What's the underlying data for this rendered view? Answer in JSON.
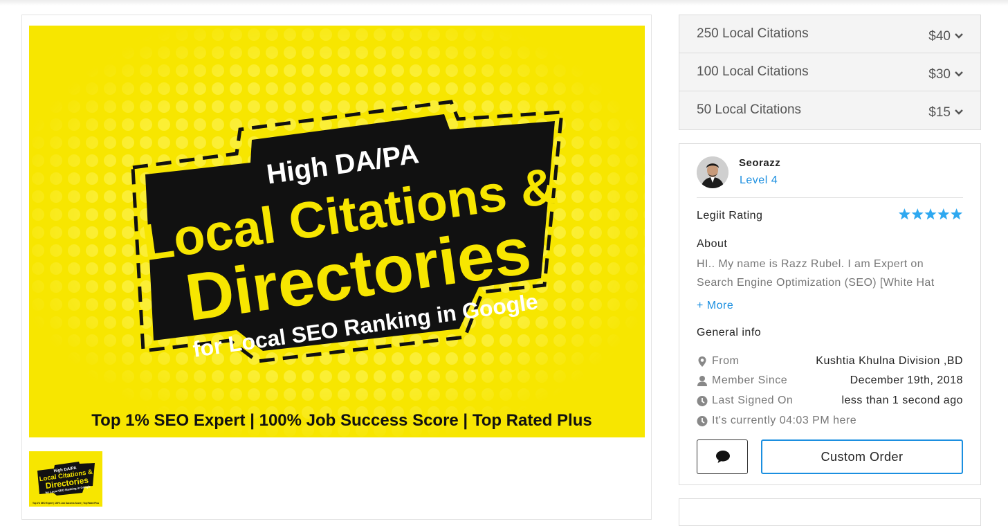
{
  "gallery": {
    "main_image": {
      "line1": "High DA/PA",
      "line2": "Local Citations &",
      "line3": "Directories",
      "line4": "for Local SEO Ranking in Google",
      "footer": "Top 1% SEO Expert  | 100% Job Success Score | Top Rated Plus"
    },
    "thumbnail": {
      "line1": "High DA/PA",
      "line2": "Local Citations &",
      "line3": "Directories",
      "line4": "for Local SEO Ranking in Google",
      "footer": "Top 1% SEO Expert | 100% Job Success Score | Top Rated Plus"
    }
  },
  "packages": [
    {
      "name": "250 Local Citations",
      "price": "$40"
    },
    {
      "name": "100 Local Citations",
      "price": "$30"
    },
    {
      "name": "50 Local Citations",
      "price": "$15"
    }
  ],
  "seller": {
    "name": "Seorazz",
    "level": "Level 4",
    "rating_label": "Legiit Rating",
    "rating_stars": 5,
    "rating_max": 5,
    "about_title": "About",
    "about_text": "HI.. My name is Razz Rubel. I am Expert on Search Engine Optimization (SEO) [White Hat",
    "more_label": "+ More",
    "general_title": "General info",
    "info": [
      {
        "icon": "map-marker-icon",
        "label": "From",
        "value": "Kushtia Khulna Division ,BD"
      },
      {
        "icon": "user-icon",
        "label": "Member Since",
        "value": "December 19th, 2018"
      },
      {
        "icon": "clock-icon",
        "label": "Last Signed On",
        "value": "less than 1 second ago"
      },
      {
        "icon": "clock-icon",
        "label": "It's currently 04:03 PM here",
        "value": ""
      }
    ],
    "message_icon": "comment-icon",
    "custom_order_label": "Custom Order"
  },
  "colors": {
    "accent": "#1b8fe0",
    "banner_yellow": "#f7e600",
    "banner_black": "#111111",
    "star": "#2ea8f0"
  }
}
